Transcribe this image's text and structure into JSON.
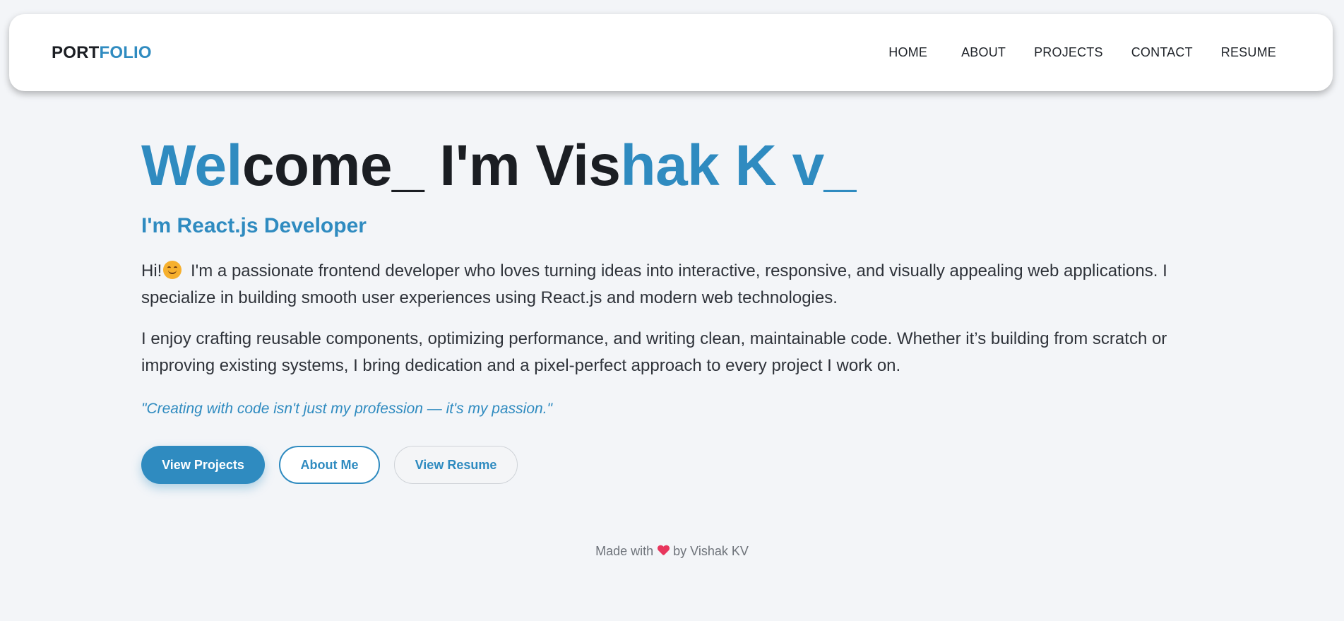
{
  "navbar": {
    "logo_part1": "PORT",
    "logo_part2": "FOLIO",
    "links": [
      "HOME",
      "ABOUT",
      "PROJECTS",
      "CONTACT",
      "RESUME"
    ]
  },
  "hero": {
    "headline": {
      "part1": "Wel",
      "part2": "come_ I'm Vis",
      "part3": "hak K v_"
    },
    "subtitle": "I'm React.js Developer",
    "paragraph1_before_emoji": "Hi!",
    "paragraph1_after_emoji": "I'm a passionate frontend developer who loves turning ideas into interactive, responsive, and visually appealing web applications. I specialize in building smooth user experiences using React.js and modern web technologies.",
    "paragraph2": "I enjoy crafting reusable components, optimizing performance, and writing clean, maintainable code. Whether it’s building from scratch or improving existing systems, I bring dedication and a pixel-perfect approach to every project I work on.",
    "quote": "\"Creating with code isn't just my profession — it's my passion.\"",
    "buttons": {
      "view_projects": "View Projects",
      "about_me": "About Me",
      "view_resume": "View Resume"
    }
  },
  "footer": {
    "before_heart": "Made with",
    "after_heart": "by Vishak KV"
  },
  "colors": {
    "accent": "#2f8bc0",
    "background": "#f3f5f8",
    "heart": "#e8365d"
  },
  "icons": {
    "emoji": "smiling-face-icon",
    "heart": "heart-icon"
  }
}
